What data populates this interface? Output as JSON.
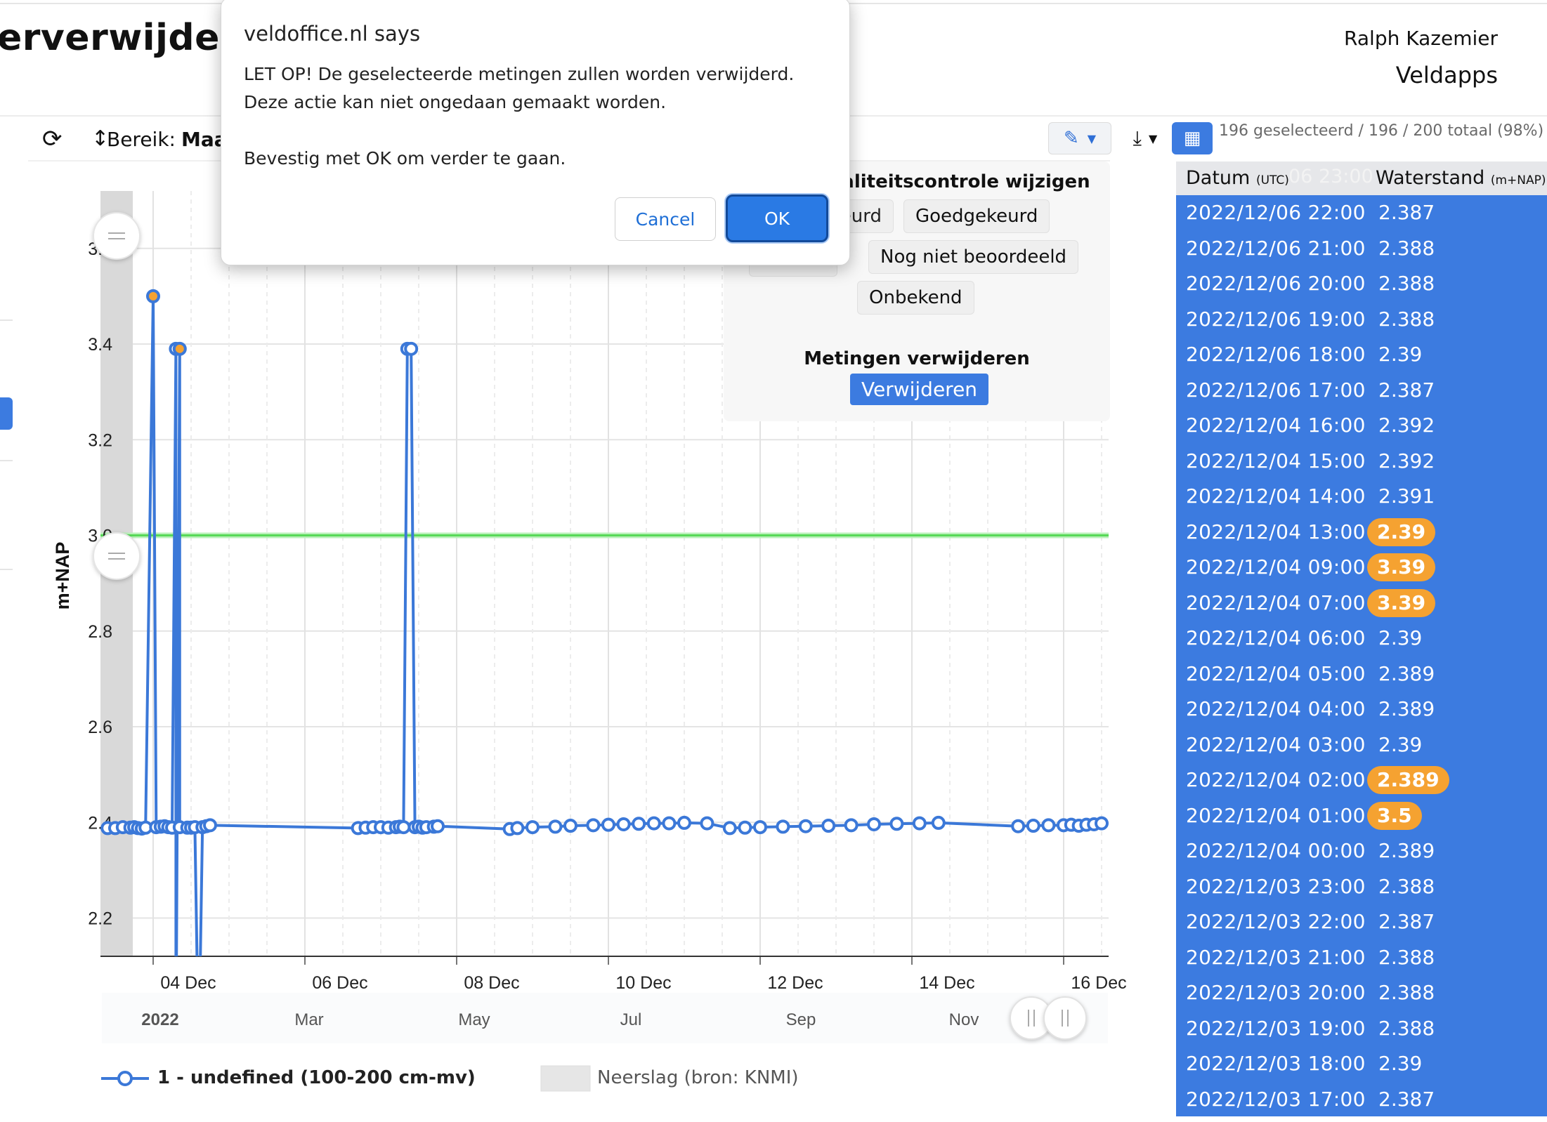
{
  "header": {
    "title": "erverwijderen",
    "user_name": "Ralph Kazemier",
    "app_name": "Veldapps"
  },
  "toolbar": {
    "refresh_icon": "refresh-icon",
    "range_label": "Bereik:",
    "range_value": "Maa",
    "edit_icon": "pencil-icon",
    "download_icon": "download-icon",
    "table_icon": "table-icon",
    "selection_count": "196 geselecteerd / 196 / 200 totaal (98%)"
  },
  "dialog": {
    "title": "veldoffice.nl says",
    "message_line1": "LET OP! De geselecteerde metingen zullen worden verwijderd.",
    "message_line2": "Deze actie kan niet ongedaan gemaakt worden.",
    "message_line3": "Bevestig met OK om verder te gaan.",
    "cancel_label": "Cancel",
    "ok_label": "OK"
  },
  "quality_panel": {
    "title": "Kwaliteitscontrole wijzigen",
    "title_visible": "aliteitscontrole wijzigen",
    "buttons": [
      "eurd",
      "Goedgekeurd",
      "Nog niet beoordeeld",
      "Onbekend"
    ],
    "delete_title": "Metingen verwijderen",
    "delete_button": "Verwijderen"
  },
  "table": {
    "col_date": "Datum",
    "col_date_unit": "(UTC)",
    "col_date_ghost": "06 23:00",
    "col_value": "Waterstand",
    "col_value_unit": "(m+NAP)",
    "flag_color": "#f5a231",
    "rows": [
      {
        "date": "2022/12/06 22:00",
        "value": "2.387",
        "flag": false
      },
      {
        "date": "2022/12/06 21:00",
        "value": "2.388",
        "flag": false
      },
      {
        "date": "2022/12/06 20:00",
        "value": "2.388",
        "flag": false
      },
      {
        "date": "2022/12/06 19:00",
        "value": "2.388",
        "flag": false
      },
      {
        "date": "2022/12/06 18:00",
        "value": "2.39",
        "flag": false
      },
      {
        "date": "2022/12/06 17:00",
        "value": "2.387",
        "flag": false
      },
      {
        "date": "2022/12/04 16:00",
        "value": "2.392",
        "flag": false
      },
      {
        "date": "2022/12/04 15:00",
        "value": "2.392",
        "flag": false
      },
      {
        "date": "2022/12/04 14:00",
        "value": "2.391",
        "flag": false
      },
      {
        "date": "2022/12/04 13:00",
        "value": "2.39",
        "flag": true
      },
      {
        "date": "2022/12/04 09:00",
        "value": "3.39",
        "flag": true
      },
      {
        "date": "2022/12/04 07:00",
        "value": "3.39",
        "flag": true
      },
      {
        "date": "2022/12/04 06:00",
        "value": "2.39",
        "flag": false
      },
      {
        "date": "2022/12/04 05:00",
        "value": "2.389",
        "flag": false
      },
      {
        "date": "2022/12/04 04:00",
        "value": "2.389",
        "flag": false
      },
      {
        "date": "2022/12/04 03:00",
        "value": "2.39",
        "flag": false
      },
      {
        "date": "2022/12/04 02:00",
        "value": "2.389",
        "flag": true
      },
      {
        "date": "2022/12/04 01:00",
        "value": "3.5",
        "flag": true
      },
      {
        "date": "2022/12/04 00:00",
        "value": "2.389",
        "flag": false
      },
      {
        "date": "2022/12/03 23:00",
        "value": "2.388",
        "flag": false
      },
      {
        "date": "2022/12/03 22:00",
        "value": "2.387",
        "flag": false
      },
      {
        "date": "2022/12/03 21:00",
        "value": "2.388",
        "flag": false
      },
      {
        "date": "2022/12/03 20:00",
        "value": "2.388",
        "flag": false
      },
      {
        "date": "2022/12/03 19:00",
        "value": "2.388",
        "flag": false
      },
      {
        "date": "2022/12/03 18:00",
        "value": "2.39",
        "flag": false
      },
      {
        "date": "2022/12/03 17:00",
        "value": "2.387",
        "flag": false
      }
    ]
  },
  "legend": {
    "series_label": "1 - undefined (100-200 cm-mv)",
    "rain_label": "Neerslag (bron: KNMI)"
  },
  "chart_data": {
    "type": "line",
    "ylabel": "m+NAP",
    "ylim": [
      2.12,
      3.72
    ],
    "y_ticks": [
      "2.2",
      "2.4",
      "2.6",
      "2.8",
      "3.0",
      "3.2",
      "3.4",
      "3.6"
    ],
    "x_ticks": [
      "04 Dec",
      "06 Dec",
      "08 Dec",
      "10 Dec",
      "12 Dec",
      "14 Dec",
      "16 Dec"
    ],
    "navigator_labels": [
      "2022",
      "Mar",
      "May",
      "Jul",
      "Sep",
      "Nov"
    ],
    "threshold_line": 3.0,
    "series_color": "#3b78d8",
    "threshold_color": "#57d957",
    "series": [
      {
        "name": "1 - undefined (100-200 cm-mv)",
        "x_days": [
          3.4,
          3.5,
          3.6,
          3.7,
          3.75,
          3.8,
          3.85,
          3.9,
          4.0,
          4.04,
          4.1,
          4.15,
          4.2,
          4.25,
          4.3,
          4.3,
          4.35,
          4.35,
          4.45,
          4.5,
          4.55,
          4.6,
          4.65,
          4.7,
          4.75,
          6.7,
          6.8,
          6.9,
          7.0,
          7.1,
          7.2,
          7.25,
          7.3,
          7.35,
          7.4,
          7.45,
          7.5,
          7.55,
          7.6,
          7.7,
          7.75,
          8.7,
          8.8,
          9.0,
          9.3,
          9.5,
          9.8,
          10.0,
          10.2,
          10.4,
          10.6,
          10.8,
          11.0,
          11.3,
          11.6,
          11.8,
          12.0,
          12.3,
          12.6,
          12.9,
          13.2,
          13.5,
          13.8,
          14.1,
          14.35,
          15.4,
          15.6,
          15.8,
          16.0,
          16.1,
          16.2,
          16.3,
          16.4,
          16.5
        ],
        "values": [
          2.388,
          2.388,
          2.39,
          2.389,
          2.39,
          2.388,
          2.387,
          2.389,
          3.5,
          2.39,
          2.391,
          2.392,
          2.39,
          2.389,
          3.39,
          1.9,
          3.39,
          2.39,
          2.389,
          2.389,
          2.39,
          1.9,
          2.39,
          2.392,
          2.394,
          2.388,
          2.389,
          2.39,
          2.39,
          2.389,
          2.39,
          2.391,
          2.39,
          3.39,
          3.39,
          2.39,
          2.391,
          2.389,
          2.39,
          2.391,
          2.392,
          2.386,
          2.388,
          2.39,
          2.391,
          2.393,
          2.394,
          2.395,
          2.396,
          2.397,
          2.398,
          2.398,
          2.399,
          2.398,
          2.388,
          2.389,
          2.39,
          2.391,
          2.392,
          2.393,
          2.394,
          2.396,
          2.397,
          2.398,
          2.399,
          2.392,
          2.393,
          2.394,
          2.394,
          2.395,
          2.393,
          2.395,
          2.396,
          2.398
        ],
        "selected_points": [
          [
            4.0,
            3.5
          ],
          [
            4.35,
            3.39
          ]
        ]
      }
    ]
  }
}
